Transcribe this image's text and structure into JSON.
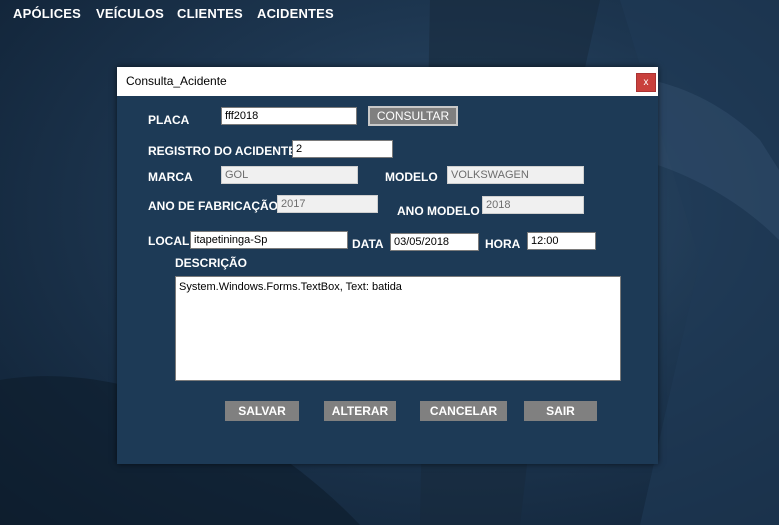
{
  "menu": {
    "apolices": "APÓLICES",
    "veiculos": "VEÍCULOS",
    "clientes": "CLIENTES",
    "acidentes": "ACIDENTES"
  },
  "dialog": {
    "title": "Consulta_Acidente",
    "close": "x"
  },
  "form": {
    "placa_label": "PLACA",
    "placa_value": "fff2018",
    "consultar_label": "CONSULTAR",
    "registro_label": "REGISTRO DO ACIDENTE",
    "registro_value": "2",
    "marca_label": "MARCA",
    "marca_value": "GOL",
    "modelo_label": "MODELO",
    "modelo_value": "VOLKSWAGEN",
    "ano_fab_label": "ANO DE FABRICAÇÃO",
    "ano_fab_value": "2017",
    "ano_modelo_label": "ANO MODELO",
    "ano_modelo_value": "2018",
    "local_label": "LOCAL",
    "local_value": "itapetininga-Sp",
    "data_label": "DATA",
    "data_value": "03/05/2018",
    "hora_label": "HORA",
    "hora_value": "12:00",
    "descricao_label": "DESCRIÇÃO",
    "descricao_value": "System.Windows.Forms.TextBox, Text: batida"
  },
  "buttons": {
    "salvar": "SALVAR",
    "alterar": "ALTERAR",
    "cancelar": "CANCELAR",
    "sair": "SAIR"
  }
}
